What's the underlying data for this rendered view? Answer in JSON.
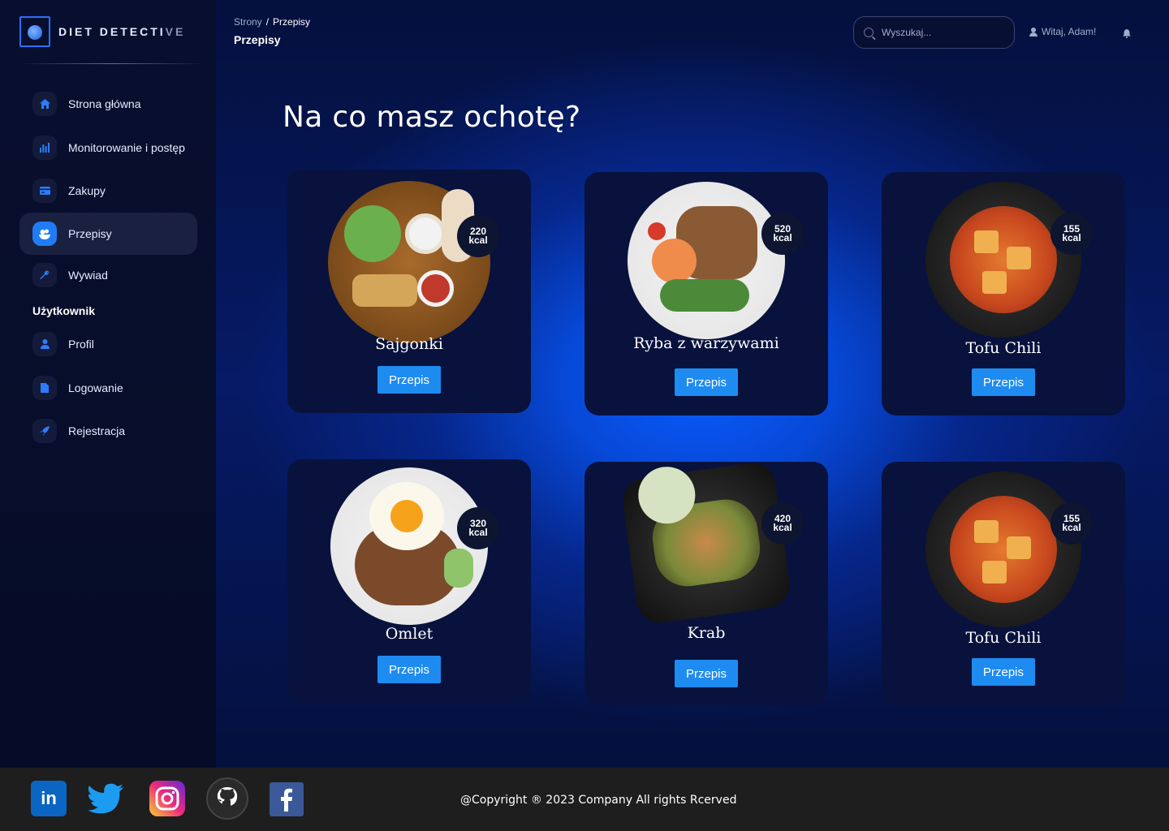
{
  "brand": {
    "name_main": "DIET DETECTI",
    "name_dim": "VE"
  },
  "sidebar": {
    "items": [
      {
        "label": "Strona główna",
        "icon": "home-icon"
      },
      {
        "label": "Monitorowanie i postęp",
        "icon": "chart-icon"
      },
      {
        "label": "Zakupy",
        "icon": "card-icon"
      },
      {
        "label": "Przepisy",
        "icon": "recipes-icon",
        "active": true
      },
      {
        "label": "Wywiad",
        "icon": "wrench-icon"
      }
    ],
    "section_user": "Użytkownik",
    "user_items": [
      {
        "label": "Profil",
        "icon": "person-icon"
      },
      {
        "label": "Logowanie",
        "icon": "document-icon"
      },
      {
        "label": "Rejestracja",
        "icon": "rocket-icon"
      }
    ]
  },
  "header": {
    "breadcrumb_root": "Strony",
    "breadcrumb_sep": "/",
    "breadcrumb_current": "Przepisy",
    "title": "Przepisy",
    "search_placeholder": "Wyszukaj...",
    "greeting": "Witaj, Adam!"
  },
  "main": {
    "heading": "Na co masz ochotę?",
    "cards": [
      {
        "name": "Sajgonki",
        "kcal": "220",
        "kcal_unit": "kcal",
        "button": "Przepis"
      },
      {
        "name": "Ryba z warzywami",
        "kcal": "520",
        "kcal_unit": "kcal",
        "button": "Przepis"
      },
      {
        "name": "Tofu Chili",
        "kcal": "155",
        "kcal_unit": "kcal",
        "button": "Przepis"
      },
      {
        "name": "Omlet",
        "kcal": "320",
        "kcal_unit": "kcal",
        "button": "Przepis"
      },
      {
        "name": "Krab",
        "kcal": "420",
        "kcal_unit": "kcal",
        "button": "Przepis"
      },
      {
        "name": "Tofu Chili",
        "kcal": "155",
        "kcal_unit": "kcal",
        "button": "Przepis"
      }
    ]
  },
  "footer": {
    "copyright": "@Copyright ® 2023 Company All rights Rcerved",
    "social": [
      "linkedin-icon",
      "twitter-icon",
      "instagram-icon",
      "github-icon",
      "facebook-icon"
    ]
  },
  "colors": {
    "accent": "#1e8bf0",
    "sidebar_bg": "#080f2e",
    "card_bg": "#08123d",
    "footer_bg": "#1e1e1e"
  }
}
